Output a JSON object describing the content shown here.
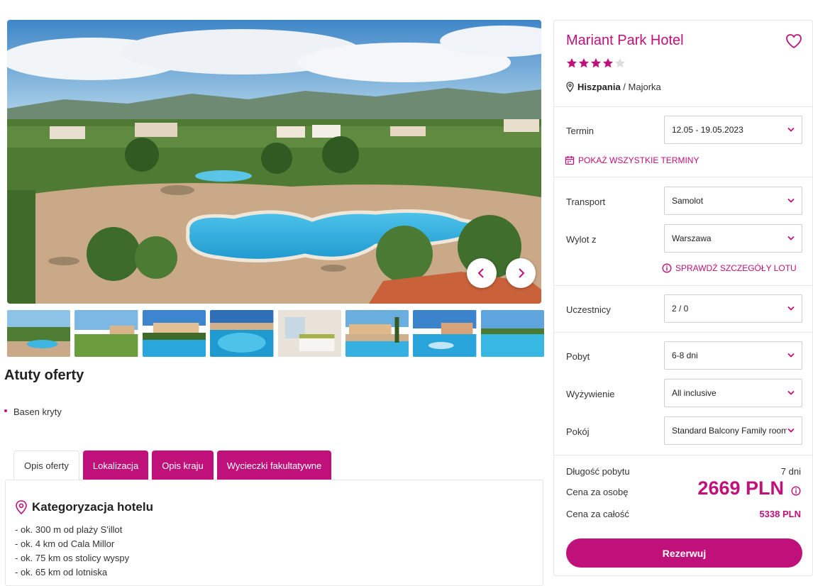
{
  "gallery": {
    "prev_icon": "chevron-left-icon",
    "next_icon": "chevron-right-icon",
    "thumbnails": [
      "resort overview",
      "garden lawn",
      "pool with hotel",
      "pool close-up",
      "hotel room",
      "palm trees pool",
      "pool fountain",
      "pool and sky"
    ]
  },
  "atuty": {
    "title": "Atuty oferty",
    "items": [
      "Basen kryty"
    ]
  },
  "tabs": [
    {
      "label": "Opis oferty",
      "active": true
    },
    {
      "label": "Lokalizacja",
      "active": false
    },
    {
      "label": "Opis kraju",
      "active": false
    },
    {
      "label": "Wycieczki fakultatywne",
      "active": false
    }
  ],
  "description": {
    "heading": "Kategoryzacja hotelu",
    "lines": [
      "- ok. 300 m od plaży S'illot",
      "- ok. 4 km od Cala Millor",
      "- ok. 75 km os stolicy wyspy",
      "- ok. 65 km od lotniska"
    ]
  },
  "hotel": {
    "name": "Mariant Park Hotel",
    "rating": 4,
    "max_rating": 5,
    "country": "Hiszpania",
    "separator": " / ",
    "region": "Majorka"
  },
  "booking": {
    "termin_label": "Termin",
    "termin_value": "12.05 - 19.05.2023",
    "all_dates_link": "POKAŻ WSZYSTKIE TERMINY",
    "transport_label": "Transport",
    "transport_value": "Samolot",
    "departure_label": "Wylot z",
    "departure_value": "Warszawa",
    "flight_details_link": "SPRAWDŹ SZCZEGÓŁY LOTU",
    "participants_label": "Uczestnicy",
    "participants_value": "2 / 0",
    "stay_label": "Pobyt",
    "stay_value": "6-8 dni",
    "board_label": "Wyżywienie",
    "board_value": "All inclusive",
    "room_label": "Pokój",
    "room_value": "Standard Balcony Family room"
  },
  "summary": {
    "length_label": "Długość pobytu",
    "length_value": "7 dni",
    "per_person_label": "Cena za osobę",
    "per_person_value": "2669 PLN",
    "total_label": "Cena za całość",
    "total_value": "5338 PLN",
    "book_button": "Rezerwuj"
  },
  "colors": {
    "accent": "#c0107a",
    "star_empty": "#dddddd"
  }
}
